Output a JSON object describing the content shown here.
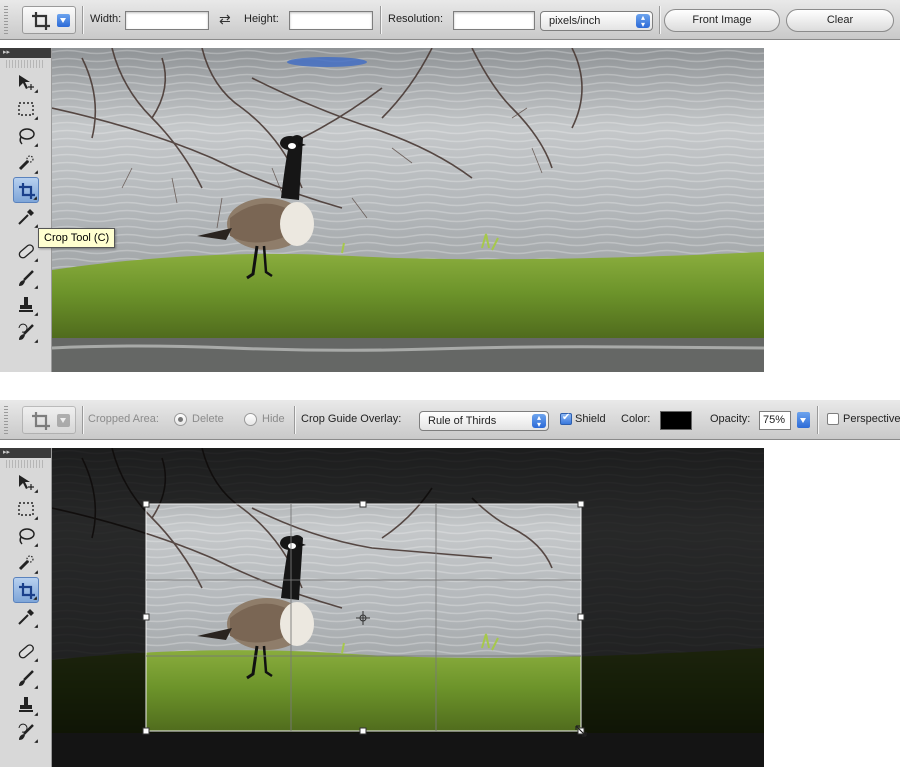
{
  "top_options": {
    "width_label": "Width:",
    "width_value": "",
    "height_label": "Height:",
    "height_value": "",
    "resolution_label": "Resolution:",
    "resolution_value": "",
    "resolution_unit": "pixels/inch",
    "front_image_label": "Front Image",
    "clear_label": "Clear"
  },
  "bottom_options": {
    "cropped_area_label": "Cropped Area:",
    "delete_label": "Delete",
    "hide_label": "Hide",
    "crop_guide_label": "Crop Guide Overlay:",
    "crop_guide_value": "Rule of Thirds",
    "shield_label": "Shield",
    "shield_checked": true,
    "color_label": "Color:",
    "shield_color": "#000000",
    "opacity_label": "Opacity:",
    "opacity_value": "75%",
    "perspective_label": "Perspective",
    "perspective_checked": false
  },
  "toolbox": {
    "header": "▸▸",
    "tools": [
      "move-tool",
      "marquee-tool",
      "lasso-tool",
      "quick-selection-tool",
      "crop-tool",
      "eyedropper-tool",
      "healing-brush-tool",
      "brush-tool",
      "clone-stamp-tool",
      "history-brush-tool"
    ],
    "active_tool": "crop-tool"
  },
  "tooltip": {
    "text": "Crop Tool (C)"
  },
  "colors": {
    "accent_blue": "#2c6ad7",
    "tooltip_bg": "#ffffd0"
  }
}
